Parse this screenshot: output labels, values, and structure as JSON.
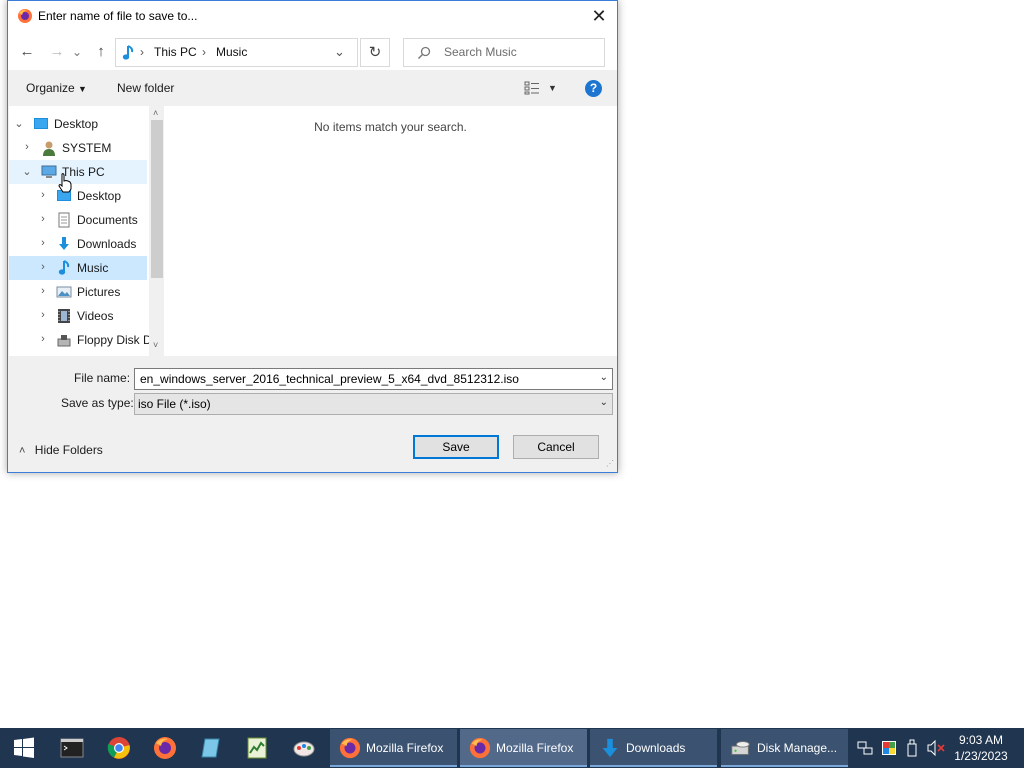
{
  "dialog": {
    "title": "Enter name of file to save to...",
    "close_glyph": "✕"
  },
  "nav": {
    "back_glyph": "←",
    "forward_glyph": "→",
    "recent_glyph": "⌄",
    "up_glyph": "↑",
    "breadcrumb": [
      "This PC",
      "Music"
    ],
    "crumb_sep": "›",
    "refresh_glyph": "↻",
    "search_placeholder": "Search Music"
  },
  "toolbar": {
    "organize": "Organize",
    "new_folder": "New folder",
    "help": "?"
  },
  "tree": {
    "items": [
      {
        "label": "Desktop",
        "icon": "desktop-icon"
      },
      {
        "label": "SYSTEM",
        "icon": "user-icon"
      },
      {
        "label": "This PC",
        "icon": "computer-icon"
      },
      {
        "label": "Desktop",
        "icon": "desktop-icon"
      },
      {
        "label": "Documents",
        "icon": "documents-icon"
      },
      {
        "label": "Downloads",
        "icon": "downloads-icon"
      },
      {
        "label": "Music",
        "icon": "music-icon"
      },
      {
        "label": "Pictures",
        "icon": "pictures-icon"
      },
      {
        "label": "Videos",
        "icon": "videos-icon"
      },
      {
        "label": "Floppy Disk Dri",
        "icon": "floppy-icon"
      }
    ]
  },
  "files": {
    "empty_message": "No items match your search."
  },
  "form": {
    "file_name_label": "File name:",
    "file_name_value": "en_windows_server_2016_technical_preview_5_x64_dvd_8512312.iso",
    "save_type_label": "Save as type:",
    "save_type_value": "iso File (*.iso)",
    "hide_folders": "Hide Folders",
    "save": "Save",
    "cancel": "Cancel"
  },
  "taskbar": {
    "tasks": [
      {
        "label": "Mozilla Firefox"
      },
      {
        "label": "Mozilla Firefox"
      },
      {
        "label": "Downloads"
      },
      {
        "label": "Disk Manage..."
      }
    ],
    "time": "9:03 AM",
    "date": "1/23/2023"
  },
  "colors": {
    "accent": "#0078d7",
    "selection": "#cce8ff",
    "taskbar": "#1f3550"
  }
}
